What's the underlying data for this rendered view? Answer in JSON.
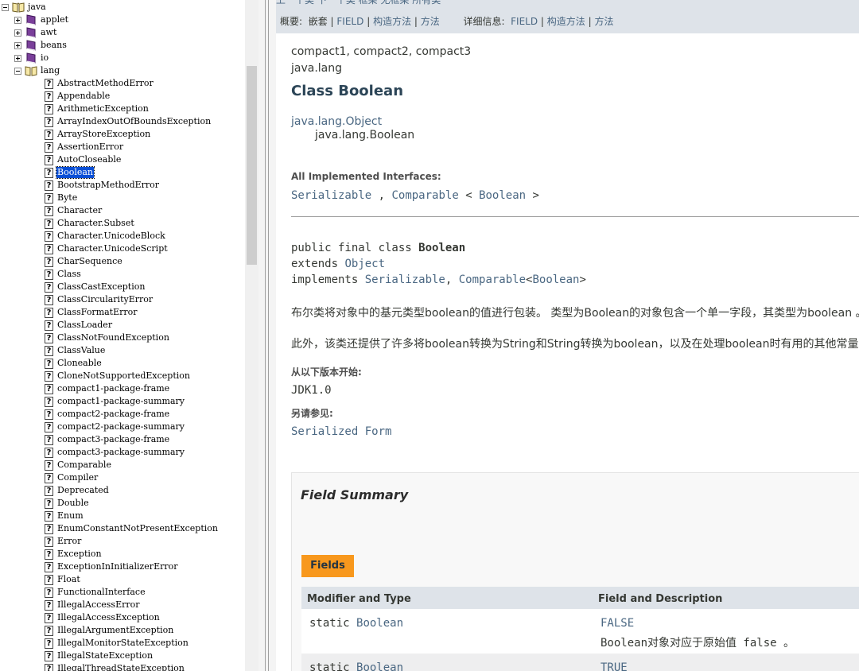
{
  "tree": {
    "root": "java",
    "collapsed_packages": [
      "applet",
      "awt",
      "beans",
      "io"
    ],
    "expanded_package": "lang",
    "classes": [
      "AbstractMethodError",
      "Appendable",
      "ArithmeticException",
      "ArrayIndexOutOfBoundsException",
      "ArrayStoreException",
      "AssertionError",
      "AutoCloseable",
      "Boolean",
      "BootstrapMethodError",
      "Byte",
      "Character",
      "Character.Subset",
      "Character.UnicodeBlock",
      "Character.UnicodeScript",
      "CharSequence",
      "Class",
      "ClassCastException",
      "ClassCircularityError",
      "ClassFormatError",
      "ClassLoader",
      "ClassNotFoundException",
      "ClassValue",
      "Cloneable",
      "CloneNotSupportedException",
      "compact1-package-frame",
      "compact1-package-summary",
      "compact2-package-frame",
      "compact2-package-summary",
      "compact3-package-frame",
      "compact3-package-summary",
      "Comparable",
      "Compiler",
      "Deprecated",
      "Double",
      "Enum",
      "EnumConstantNotPresentException",
      "Error",
      "Exception",
      "ExceptionInInitializerError",
      "Float",
      "FunctionalInterface",
      "IllegalAccessError",
      "IllegalAccessException",
      "IllegalArgumentException",
      "IllegalMonitorStateException",
      "IllegalStateException",
      "IllegalThreadStateException"
    ],
    "selected": "Boolean",
    "doc_icon": "?"
  },
  "topnav_clipped": "上一个类   下一个类        框架   无框架        所有类",
  "subnav": {
    "summary_label": "概要:",
    "summary_items": [
      "嵌套",
      "FIELD",
      "构造方法",
      "方法"
    ],
    "detail_label": "详细信息:",
    "detail_items": [
      "FIELD",
      "构造方法",
      "方法"
    ],
    "sep": "|"
  },
  "doc": {
    "profiles": "compact1, compact2, compact3",
    "package": "java.lang",
    "title": "Class Boolean",
    "inherit_parent": "java.lang.Object",
    "inherit_child": "java.lang.Boolean",
    "impl_label": "All Implemented Interfaces:",
    "impl_iface1": "Serializable",
    "impl_comma": ",",
    "impl_iface2": "Comparable",
    "impl_lt": "<",
    "impl_type": "Boolean",
    "impl_gt": ">",
    "decl_prefix": "public final class ",
    "decl_name": "Boolean",
    "decl_extends": "extends ",
    "decl_object": "Object",
    "decl_implements": "implements ",
    "decl_serializable": "Serializable",
    "decl_comma": ", ",
    "decl_comparable": "Comparable",
    "decl_lt": "<",
    "decl_boolean": "Boolean",
    "decl_gt": ">",
    "desc1": "布尔类将对象中的基元类型boolean的值进行包装。 类型为Boolean的对象包含一个单一字段，其类型为boolean 。",
    "desc2": "此外，该类还提供了许多将boolean转换为String和String转换为boolean，以及在处理boolean时有用的其他常量和方法。",
    "since_label": "从以下版本开始:",
    "since_value": "JDK1.0",
    "see_label": "另请参见:",
    "see_value": "Serialized Form"
  },
  "field_summary": {
    "heading": "Field Summary",
    "tab": "Fields",
    "col1": "Modifier and Type",
    "col2": "Field and Description",
    "rows": [
      {
        "modifier": "static ",
        "type": "Boolean",
        "name": "FALSE",
        "desc": "Boolean对象对应于原始值 false 。"
      },
      {
        "modifier": "static ",
        "type": "Boolean",
        "name": "TRUE"
      }
    ]
  }
}
